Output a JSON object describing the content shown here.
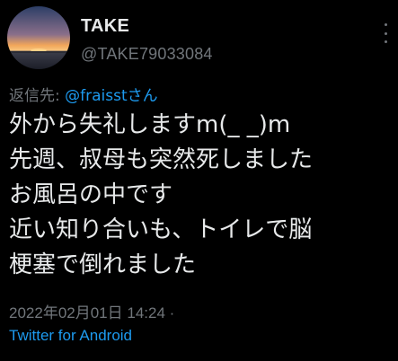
{
  "user": {
    "display_name": "TAKE",
    "handle": "@TAKE79033084",
    "avatar_icon": "sunset-avatar"
  },
  "reply": {
    "prefix": "返信先: ",
    "mention": "@fraisstさん"
  },
  "tweet": {
    "lines": [
      "外から失礼しますm(_ _)m",
      "先週、叔母も突然死しました",
      "お風呂の中です",
      "近い知り合いも、トイレで脳",
      "梗塞で倒れました"
    ]
  },
  "meta": {
    "timestamp": "2022年02月01日 14:24 ·",
    "source": "Twitter for Android"
  },
  "colors": {
    "background": "#000000",
    "text": "#e7e9ea",
    "muted": "#71767b",
    "accent": "#1d9bf0"
  },
  "icons": {
    "more": "more-vertical-icon"
  }
}
